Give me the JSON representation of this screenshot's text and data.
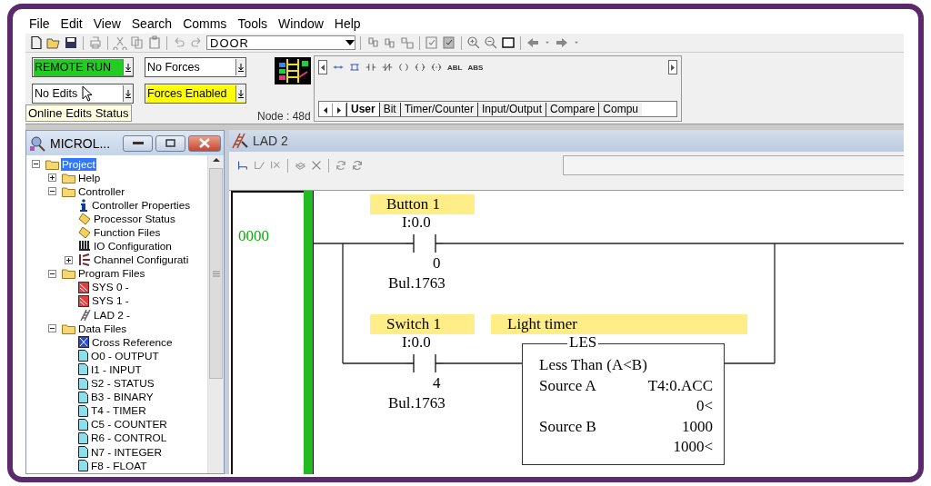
{
  "menu": [
    "File",
    "Edit",
    "View",
    "Search",
    "Comms",
    "Tools",
    "Window",
    "Help"
  ],
  "toolbar": {
    "project_combo": "DOOR"
  },
  "status_fields": [
    {
      "value": "REMOTE RUN",
      "color": "#22cc22"
    },
    {
      "value": "No Forces",
      "color": "#ffffff"
    },
    {
      "value": "No Edits",
      "color": "#ffffff"
    },
    {
      "value": "Forces Enabled",
      "color": "#ffff00"
    }
  ],
  "tooltip": "Online Edits Status",
  "node": "Node : 48d",
  "palette": {
    "text_buttons": [
      "ABL",
      "ABS"
    ],
    "tabs": [
      {
        "label": "User",
        "selected": true
      },
      {
        "label": "Bit",
        "selected": false
      },
      {
        "label": "Timer/Counter",
        "selected": false
      },
      {
        "label": "Input/Output",
        "selected": false
      },
      {
        "label": "Compare",
        "selected": false
      },
      {
        "label": "Compu",
        "selected": false
      }
    ]
  },
  "project_window": {
    "title": "MICROL...",
    "tree": [
      {
        "label": "Project",
        "kind": "folder",
        "selected": true,
        "expanded": true,
        "children": [
          {
            "label": "Help",
            "kind": "folder",
            "selected": false,
            "expanded": false
          },
          {
            "label": "Controller",
            "kind": "folder",
            "selected": false,
            "expanded": true,
            "children": [
              {
                "label": "Controller Properties",
                "kind": "properties",
                "selected": false
              },
              {
                "label": "Processor Status",
                "kind": "status",
                "selected": false
              },
              {
                "label": "Function Files",
                "kind": "status",
                "selected": false
              },
              {
                "label": "IO Configuration",
                "kind": "io",
                "selected": false
              },
              {
                "label": "Channel Configurati",
                "kind": "channel",
                "selected": false,
                "expanded": false
              }
            ]
          },
          {
            "label": "Program Files",
            "kind": "folder",
            "selected": false,
            "expanded": true,
            "children": [
              {
                "label": "SYS 0 -",
                "kind": "system-program",
                "selected": false
              },
              {
                "label": "SYS 1 -",
                "kind": "system-program",
                "selected": false
              },
              {
                "label": "LAD 2 -",
                "kind": "ladder-program",
                "selected": false
              }
            ]
          },
          {
            "label": "Data Files",
            "kind": "folder",
            "selected": false,
            "expanded": true,
            "children": [
              {
                "label": "Cross Reference",
                "kind": "cross-reference",
                "selected": false
              },
              {
                "label": "O0 - OUTPUT",
                "kind": "data-file",
                "selected": false
              },
              {
                "label": "I1 - INPUT",
                "kind": "data-file",
                "selected": false
              },
              {
                "label": "S2 - STATUS",
                "kind": "data-file",
                "selected": false
              },
              {
                "label": "B3 - BINARY",
                "kind": "data-file",
                "selected": false
              },
              {
                "label": "T4 - TIMER",
                "kind": "data-file",
                "selected": false
              },
              {
                "label": "C5 - COUNTER",
                "kind": "data-file",
                "selected": false
              },
              {
                "label": "R6 - CONTROL",
                "kind": "data-file",
                "selected": false
              },
              {
                "label": "N7 - INTEGER",
                "kind": "data-file",
                "selected": false
              },
              {
                "label": "F8 - FLOAT",
                "kind": "data-file",
                "selected": false
              }
            ]
          }
        ]
      }
    ]
  },
  "ladder_window": {
    "title": "LAD 2",
    "rungs": [
      {
        "number": "0000",
        "branches": [
          {
            "contact": {
              "tag": "Button 1",
              "address": "I:0.0",
              "bit": "0",
              "module": "Bul.1763"
            }
          },
          {
            "contact": {
              "tag": "Switch 1",
              "address": "I:0.0",
              "bit": "4",
              "module": "Bul.1763"
            },
            "instruction": {
              "tag": "Light timer",
              "mnemonic": "LES",
              "title": "Less Than (A<B)",
              "params": [
                {
                  "label": "Source A",
                  "value": "T4:0.ACC",
                  "reading": "0<"
                },
                {
                  "label": "Source B",
                  "value": "1000",
                  "reading": "1000<"
                }
              ]
            }
          }
        ]
      }
    ]
  }
}
